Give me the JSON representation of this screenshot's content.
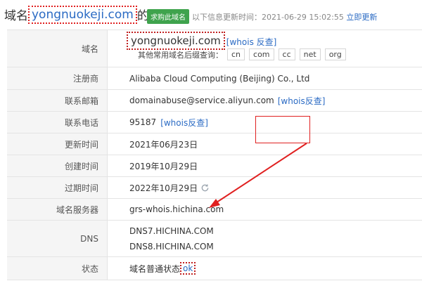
{
  "header": {
    "prefix": "域名",
    "domain": "yongnuokeji.com",
    "suffix": "的信息",
    "buy_badge": "求购此域名",
    "update_label": "以下信息更新时间：",
    "update_time": "2021-06-29 15:02:55",
    "refresh_link": "立即更新"
  },
  "rows": {
    "domain": {
      "label": "域名",
      "value": "yongnuokeji.com",
      "whois_link": "[whois 反查]",
      "suffix_label": "其他常用域名后缀查询：",
      "suffixes": [
        "cn",
        "com",
        "cc",
        "net",
        "org"
      ]
    },
    "registrar": {
      "label": "注册商",
      "value": "Alibaba Cloud Computing (Beijing) Co., Ltd"
    },
    "email": {
      "label": "联系邮箱",
      "value": "domainabuse@service.aliyun.com",
      "link": "[whois反查]"
    },
    "phone": {
      "label": "联系电话",
      "value": "95187",
      "link": "[whois反查]"
    },
    "updated": {
      "label": "更新时间",
      "value": "2021年06月23日"
    },
    "created": {
      "label": "创建时间",
      "value": "2019年10月29日"
    },
    "expires": {
      "label": "过期时间",
      "value": "2022年10月29日"
    },
    "nameserver": {
      "label": "域名服务器",
      "value": "grs-whois.hichina.com"
    },
    "dns": {
      "label": "DNS",
      "values": [
        "DNS7.HICHINA.COM",
        "DNS8.HICHINA.COM"
      ]
    },
    "status": {
      "label": "状态",
      "text": "域名普通状态",
      "link": "ok"
    }
  },
  "colors": {
    "link": "#2b6bc4",
    "badge": "#3fa34d",
    "annotation": "#e02020"
  },
  "icons": {
    "refresh": "refresh-icon"
  }
}
